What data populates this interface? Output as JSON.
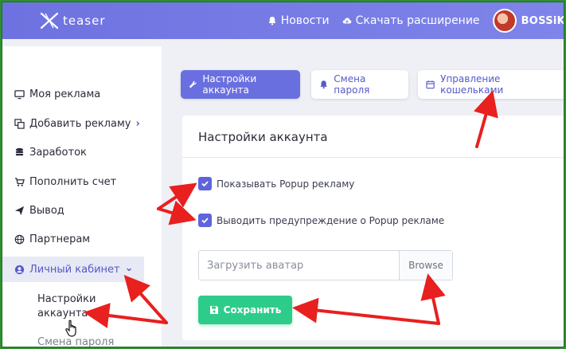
{
  "header": {
    "logo_text": "teaser",
    "nav": [
      {
        "label": "Новости",
        "icon": "bell-icon"
      },
      {
        "label": "Скачать расширение",
        "icon": "cloud-download-icon"
      }
    ],
    "user_name": "BOSSiK"
  },
  "sidebar": {
    "items": [
      {
        "label": "Моя реклама",
        "icon": "monitor-icon"
      },
      {
        "label": "Добавить рекламу",
        "icon": "copy-icon",
        "chevron": "›"
      },
      {
        "label": "Заработок",
        "icon": "coins-icon"
      },
      {
        "label": "Пополнить счет",
        "icon": "cart-icon"
      },
      {
        "label": "Вывод",
        "icon": "paper-plane-icon"
      },
      {
        "label": "Партнерам",
        "icon": "globe-icon"
      },
      {
        "label": "Личный кабинет",
        "icon": "user-circle-icon",
        "chevron": "⌄"
      }
    ],
    "sub_items": [
      {
        "label": "Настройки аккаунта"
      },
      {
        "label": "Смена пароля"
      }
    ]
  },
  "tabs": [
    {
      "label": "Настройки аккаунта",
      "icon": "wrench-icon",
      "active": true
    },
    {
      "label": "Смена пароля",
      "icon": "bell-icon",
      "active": false
    },
    {
      "label": "Управление кошельками",
      "icon": "calendar-icon",
      "active": false
    }
  ],
  "card": {
    "title": "Настройки аккаунта",
    "checkboxes": [
      {
        "label": "Показывать Popup рекламу",
        "checked": true
      },
      {
        "label": "Выводить предупреждение о Popup рекламе",
        "checked": true
      }
    ],
    "upload": {
      "placeholder": "Загрузить аватар",
      "browse_label": "Browse"
    },
    "save_label": "Сохранить"
  },
  "colors": {
    "topbar": "#7b80e6",
    "accent": "#6a6fe0",
    "save": "#2ecc8a",
    "annotation": "#e8201e",
    "frame": "#2f8f2f"
  }
}
